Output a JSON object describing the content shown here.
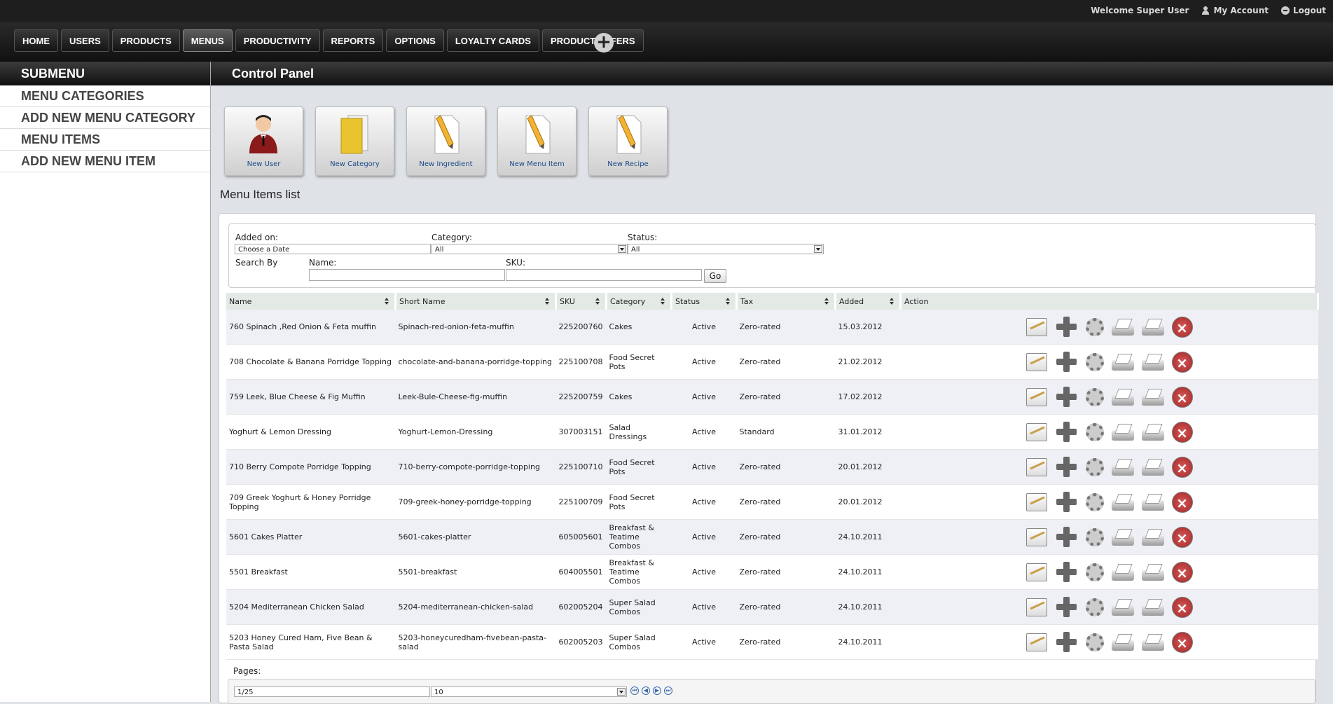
{
  "topbar": {
    "welcome": "Welcome Super User",
    "account": "My Account",
    "logout": "Logout"
  },
  "nav": {
    "tabs": [
      "HOME",
      "USERS",
      "PRODUCTS",
      "MENUS",
      "PRODUCTIVITY",
      "REPORTS",
      "OPTIONS",
      "LOYALTY CARDS",
      "PRODUCT OFFERS"
    ],
    "active": "MENUS",
    "plus": "+"
  },
  "sidebar": {
    "title": "SUBMENU",
    "items": [
      "MENU CATEGORIES",
      "ADD NEW MENU CATEGORY",
      "MENU ITEMS",
      "ADD NEW MENU ITEM"
    ]
  },
  "main": {
    "title": "Control Panel",
    "list_title": "Menu Items list"
  },
  "quick_buttons": [
    "New User",
    "New Category",
    "New Ingredient",
    "New Menu Item",
    "New Recipe"
  ],
  "filter": {
    "added_on_label": "Added on:",
    "added_on_value": "Choose a Date",
    "category_label": "Category:",
    "category_value": "All",
    "status_label": "Status:",
    "status_value": "All",
    "search_by_label": "Search By",
    "name_label": "Name:",
    "sku_label": "SKU:",
    "go_label": "Go"
  },
  "table": {
    "headers": [
      "Name",
      "Short Name",
      "SKU",
      "Category",
      "Status",
      "Tax",
      "Added",
      "Action"
    ],
    "rows": [
      [
        "760 Spinach ,Red Onion & Feta muffin",
        "Spinach-red-onion-feta-muffin",
        "225200760",
        "Cakes",
        "Active",
        "Zero-rated",
        "15.03.2012"
      ],
      [
        "708 Chocolate & Banana Porridge Topping",
        "chocolate-and-banana-porridge-topping",
        "225100708",
        "Food Secret Pots",
        "Active",
        "Zero-rated",
        "21.02.2012"
      ],
      [
        "759 Leek, Blue Cheese & Fig Muffin",
        "Leek-Bule-Cheese-fig-muffin",
        "225200759",
        "Cakes",
        "Active",
        "Zero-rated",
        "17.02.2012"
      ],
      [
        "Yoghurt & Lemon Dressing",
        "Yoghurt-Lemon-Dressing",
        "307003151",
        "Salad Dressings",
        "Active",
        "Standard",
        "31.01.2012"
      ],
      [
        "710 Berry Compote Porridge Topping",
        "710-berry-compote-porridge-topping",
        "225100710",
        "Food Secret Pots",
        "Active",
        "Zero-rated",
        "20.01.2012"
      ],
      [
        "709 Greek Yoghurt & Honey Porridge Topping",
        "709-greek-honey-porridge-topping",
        "225100709",
        "Food Secret Pots",
        "Active",
        "Zero-rated",
        "20.01.2012"
      ],
      [
        "5601 Cakes Platter",
        "5601-cakes-platter",
        "605005601",
        "Breakfast & Teatime Combos",
        "Active",
        "Zero-rated",
        "24.10.2011"
      ],
      [
        "5501 Breakfast",
        "5501-breakfast",
        "604005501",
        "Breakfast & Teatime Combos",
        "Active",
        "Zero-rated",
        "24.10.2011"
      ],
      [
        "5204 Mediterranean Chicken Salad",
        "5204-mediterranean-chicken-salad",
        "602005204",
        "Super Salad Combos",
        "Active",
        "Zero-rated",
        "24.10.2011"
      ],
      [
        "5203 Honey Cured Ham, Five Bean & Pasta Salad",
        "5203-honeycuredham-fivebean-pasta-salad",
        "602005203",
        "Super Salad Combos",
        "Active",
        "Zero-rated",
        "24.10.2011"
      ]
    ]
  },
  "pager": {
    "label": "Pages:",
    "page_value": "1/25",
    "per_page_value": "10"
  },
  "colors": {
    "topbar": "#1e1e1e",
    "row_alt": "#eef0f5",
    "link": "#1a4a8a",
    "delete": "#a42525"
  }
}
